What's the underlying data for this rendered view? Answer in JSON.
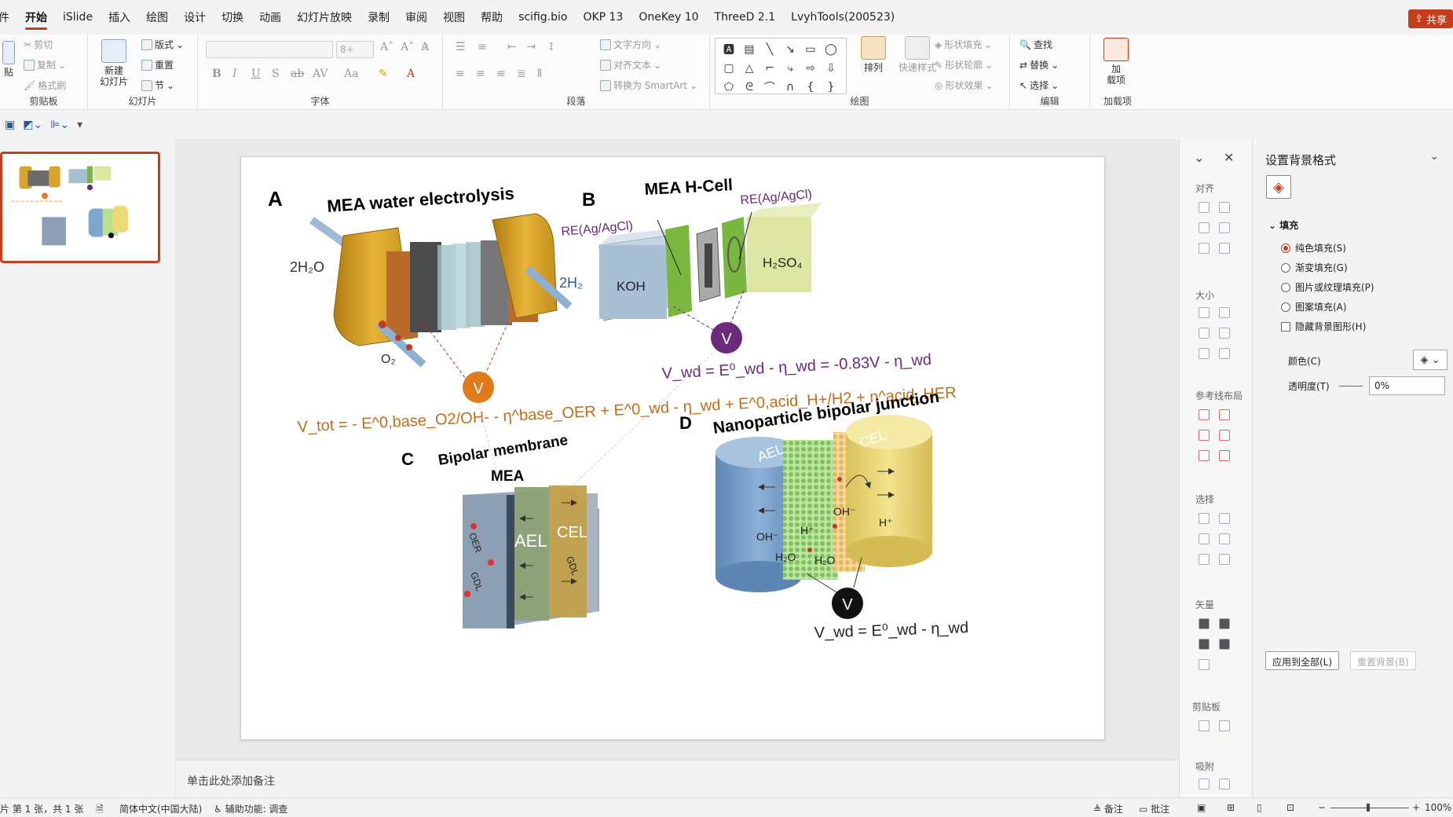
{
  "menu": {
    "items": [
      "件",
      "开始",
      "iSlide",
      "插入",
      "绘图",
      "设计",
      "切换",
      "动画",
      "幻灯片放映",
      "录制",
      "审阅",
      "视图",
      "帮助",
      "scifig.bio",
      "OKP 13",
      "OneKey 10",
      "ThreeD 2.1",
      "LvyhTools(200523)"
    ],
    "active_index": 1,
    "share_label": "共享"
  },
  "ribbon": {
    "clipboard": {
      "label": "剪贴板",
      "paste": "贴",
      "cut": "剪切",
      "copy": "复制",
      "format_painter": "格式刷"
    },
    "slides": {
      "label": "幻灯片",
      "new_slide": "新建",
      "new_slide2": "幻灯片",
      "layout": "版式",
      "reset": "重置",
      "section": "节"
    },
    "font": {
      "label": "字体",
      "size": "8+"
    },
    "paragraph": {
      "label": "段落",
      "text_direction": "文字方向",
      "align_text": "对齐文本",
      "smartart": "转换为 SmartArt"
    },
    "drawing": {
      "label": "绘图",
      "arrange": "排列",
      "quick_styles": "快速样式",
      "fill": "形状填充",
      "outline": "形状轮廓",
      "effects": "形状效果"
    },
    "editing": {
      "label": "编辑",
      "find": "查找",
      "replace": "替换",
      "select": "选择"
    },
    "addins": {
      "label": "加载项",
      "btn1": "加",
      "btn2": "载项"
    }
  },
  "notes_placeholder": "单击此处添加备注",
  "side_strip": {
    "sections": [
      "对齐",
      "大小",
      "参考线布局",
      "选择",
      "矢量",
      "剪贴板",
      "吸附"
    ]
  },
  "format_pane": {
    "title": "设置背景格式",
    "section": "填充",
    "options": [
      {
        "label": "纯色填充(S)",
        "checked": true
      },
      {
        "label": "渐变填充(G)",
        "checked": false
      },
      {
        "label": "图片或纹理填充(P)",
        "checked": false
      },
      {
        "label": "图案填充(A)",
        "checked": false
      }
    ],
    "hide_bg": "隐藏背景图形(H)",
    "color_label": "颜色(C)",
    "transparency_label": "透明度(T)",
    "transparency_value": "0%",
    "apply_all": "应用到全部(L)",
    "reset_bg": "重置背景(B)"
  },
  "status": {
    "slide_info": "片 第 1 张，共 1 张",
    "language": "简体中文(中国大陆)",
    "accessibility": "辅助功能: 调查",
    "notes": "备注",
    "comments": "批注",
    "zoom": "100%"
  },
  "slide": {
    "panel_a": {
      "letter": "A",
      "title": "MEA water electrolysis",
      "h2o": "2H₂O",
      "h2": "2H₂",
      "o2": "O₂",
      "v": "V"
    },
    "panel_b": {
      "letter": "B",
      "title": "MEA H-Cell",
      "re_left": "RE(Ag/AgCl)",
      "re_right": "RE(Ag/AgCl)",
      "koh": "KOH",
      "h2so4": "H₂SO₄",
      "v": "V",
      "equation": "V_wd = E⁰_wd - η_wd = -0.83V - η_wd"
    },
    "equation_a": "V_tot = - E^0,base_O2/OH- - η^base_OER + E^0_wd - η_wd + E^0,acid_H+/H2 + η^acid_HER",
    "panel_c": {
      "letter": "C",
      "title1": "Bipolar membrane",
      "title2": "MEA",
      "ael": "AEL",
      "cel": "CEL",
      "oer": "OER",
      "gdl": "GDL",
      "gdl2": "GDL"
    },
    "panel_d": {
      "letter": "D",
      "title": "Nanoparticle bipolar junction",
      "ael": "AEL",
      "cel": "CEL",
      "oh1": "OH⁻",
      "oh2": "OH⁻",
      "h1": "H⁺",
      "h2": "H⁺",
      "h2o1": "H₂O",
      "h2o2": "H₂O",
      "v": "V",
      "equation": "V_wd = E⁰_wd - η_wd"
    }
  }
}
